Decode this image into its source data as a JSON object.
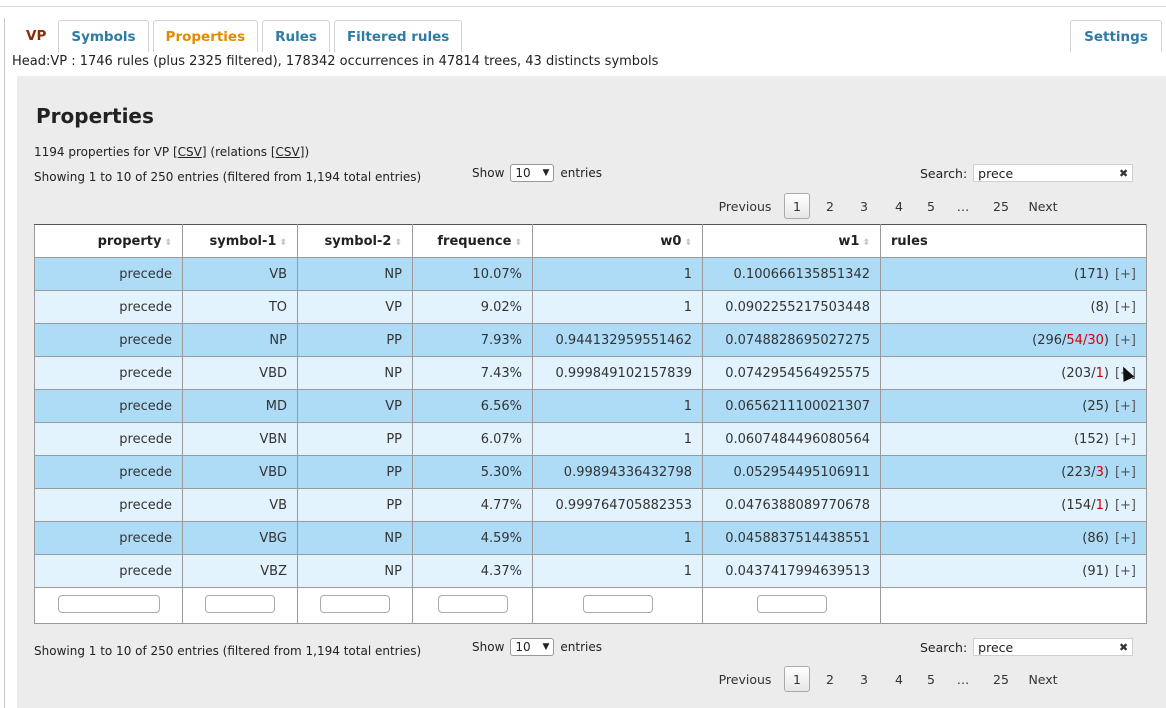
{
  "tabs": [
    {
      "label": "VP"
    },
    {
      "label": "Symbols"
    },
    {
      "label": "Properties"
    },
    {
      "label": "Rules"
    },
    {
      "label": "Filtered rules"
    }
  ],
  "settings_label": "Settings",
  "head_info": "Head:VP : 1746 rules (plus 2325 filtered), 178342 occurrences in 47814 trees, 43 distincts symbols",
  "section_title": "Properties",
  "properties_info": {
    "prefix": "1194 properties for VP [",
    "csv1": "CSV",
    "mid": "] (relations [",
    "csv2": "CSV",
    "suffix": "])"
  },
  "showing_text": "Showing 1 to 10 of 250 entries (filtered from 1,194 total entries)",
  "show_label": "Show",
  "entries_label": "entries",
  "page_length": "10",
  "search_label": "Search:",
  "search_value": "prece",
  "pager": {
    "previous": "Previous",
    "pages": [
      "1",
      "2",
      "3",
      "4",
      "5",
      "…",
      "25"
    ],
    "current": "1",
    "next": "Next"
  },
  "columns": [
    "property",
    "symbol-1",
    "symbol-2",
    "frequence",
    "w0",
    "w1",
    "rules"
  ],
  "rows": [
    {
      "property": "precede",
      "s1": "VB",
      "s2": "NP",
      "freq": "10.07%",
      "w0": "1",
      "w1": "0.100666135851342",
      "r_main": "171",
      "r_red": "",
      "plus": "[+]"
    },
    {
      "property": "precede",
      "s1": "TO",
      "s2": "VP",
      "freq": "9.02%",
      "w0": "1",
      "w1": "0.0902255217503448",
      "r_main": "8",
      "r_red": "",
      "plus": "[+]"
    },
    {
      "property": "precede",
      "s1": "NP",
      "s2": "PP",
      "freq": "7.93%",
      "w0": "0.944132959551462",
      "w1": "0.0748828695027275",
      "r_main": "296",
      "r_red": "54/30",
      "plus": "[+]"
    },
    {
      "property": "precede",
      "s1": "VBD",
      "s2": "NP",
      "freq": "7.43%",
      "w0": "0.999849102157839",
      "w1": "0.0742954564925575",
      "r_main": "203",
      "r_red": "1",
      "plus": "[+]"
    },
    {
      "property": "precede",
      "s1": "MD",
      "s2": "VP",
      "freq": "6.56%",
      "w0": "1",
      "w1": "0.0656211100021307",
      "r_main": "25",
      "r_red": "",
      "plus": "[+]"
    },
    {
      "property": "precede",
      "s1": "VBN",
      "s2": "PP",
      "freq": "6.07%",
      "w0": "1",
      "w1": "0.0607484496080564",
      "r_main": "152",
      "r_red": "",
      "plus": "[+]"
    },
    {
      "property": "precede",
      "s1": "VBD",
      "s2": "PP",
      "freq": "5.30%",
      "w0": "0.99894336432798",
      "w1": "0.052954495106911",
      "r_main": "223",
      "r_red": "3",
      "plus": "[+]"
    },
    {
      "property": "precede",
      "s1": "VB",
      "s2": "PP",
      "freq": "4.77%",
      "w0": "0.999764705882353",
      "w1": "0.0476388089770678",
      "r_main": "154",
      "r_red": "1",
      "plus": "[+]"
    },
    {
      "property": "precede",
      "s1": "VBG",
      "s2": "NP",
      "freq": "4.59%",
      "w0": "1",
      "w1": "0.0458837514438551",
      "r_main": "86",
      "r_red": "",
      "plus": "[+]"
    },
    {
      "property": "precede",
      "s1": "VBZ",
      "s2": "NP",
      "freq": "4.37%",
      "w0": "1",
      "w1": "0.0437417994639513",
      "r_main": "91",
      "r_red": "",
      "plus": "[+]"
    }
  ]
}
